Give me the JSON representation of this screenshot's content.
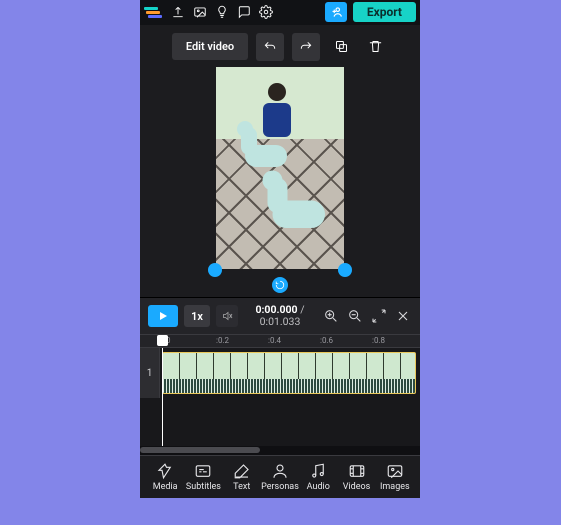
{
  "topbar": {
    "export_label": "Export"
  },
  "toolbar": {
    "edit_video_label": "Edit video"
  },
  "playback": {
    "speed_label": "1x",
    "current_time": "0:00.000",
    "separator": "/",
    "duration": "0:01.033"
  },
  "ruler": {
    "ticks": [
      ":0",
      ":0.2",
      ":0.4",
      ":0.6",
      ":0.8"
    ]
  },
  "timeline": {
    "track_number": "1"
  },
  "bottom_nav": {
    "items": [
      {
        "label": "Media"
      },
      {
        "label": "Subtitles"
      },
      {
        "label": "Text"
      },
      {
        "label": "Personas"
      },
      {
        "label": "Audio"
      },
      {
        "label": "Videos"
      },
      {
        "label": "Images"
      }
    ]
  }
}
